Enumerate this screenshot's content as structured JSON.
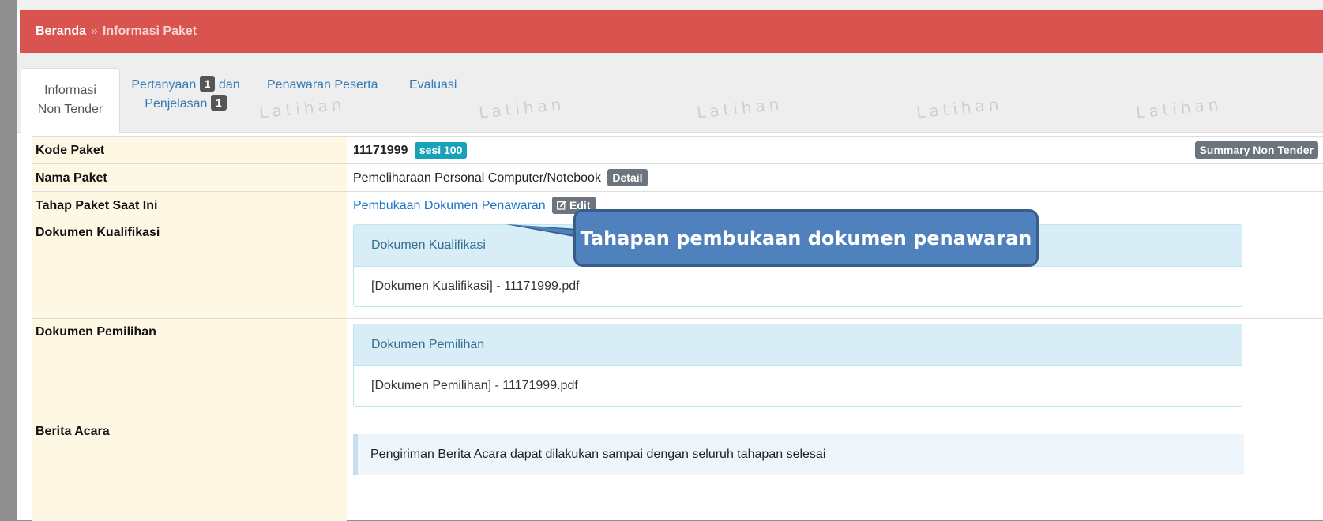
{
  "breadcrumb": {
    "home": "Beranda",
    "separator": "»",
    "current": "Informasi Paket"
  },
  "tabs": {
    "info_line1": "Informasi",
    "info_line2": "Non Tender",
    "questions_line1": "Pertanyaan",
    "questions_badge": "1",
    "questions_and": "dan",
    "questions_line2": "Penjelasan",
    "questions_badge2": "1",
    "offers": "Penawaran Peserta",
    "evaluation": "Evaluasi"
  },
  "watermark": "Latihan",
  "rows": {
    "kode": {
      "label": "Kode Paket",
      "value": "11171999",
      "session_badge": "sesi 100",
      "summary_button": "Summary Non Tender"
    },
    "nama": {
      "label": "Nama Paket",
      "value": "Pemeliharaan Personal Computer/Notebook",
      "detail_button": "Detail"
    },
    "tahap": {
      "label": "Tahap Paket Saat Ini",
      "value": "Pembukaan Dokumen Penawaran",
      "edit_button": "Edit"
    },
    "kualifikasi": {
      "label": "Dokumen Kualifikasi",
      "panel_title": "Dokumen Kualifikasi",
      "file": "[Dokumen Kualifikasi] - 11171999.pdf"
    },
    "pemilihan": {
      "label": "Dokumen Pemilihan",
      "panel_title": "Dokumen Pemilihan",
      "file": "[Dokumen Pemilihan] - 11171999.pdf"
    },
    "berita": {
      "label": "Berita Acara",
      "info": "Pengiriman Berita Acara dapat dilakukan sampai dengan seluruh tahapan selesai"
    }
  },
  "callout": "Tahapan pembukaan dokumen penawaran",
  "colors": {
    "header": "#d9534f",
    "label_bg": "#fdf7e3",
    "badge_teal": "#17a2b8",
    "callout": "#4f81bd"
  }
}
